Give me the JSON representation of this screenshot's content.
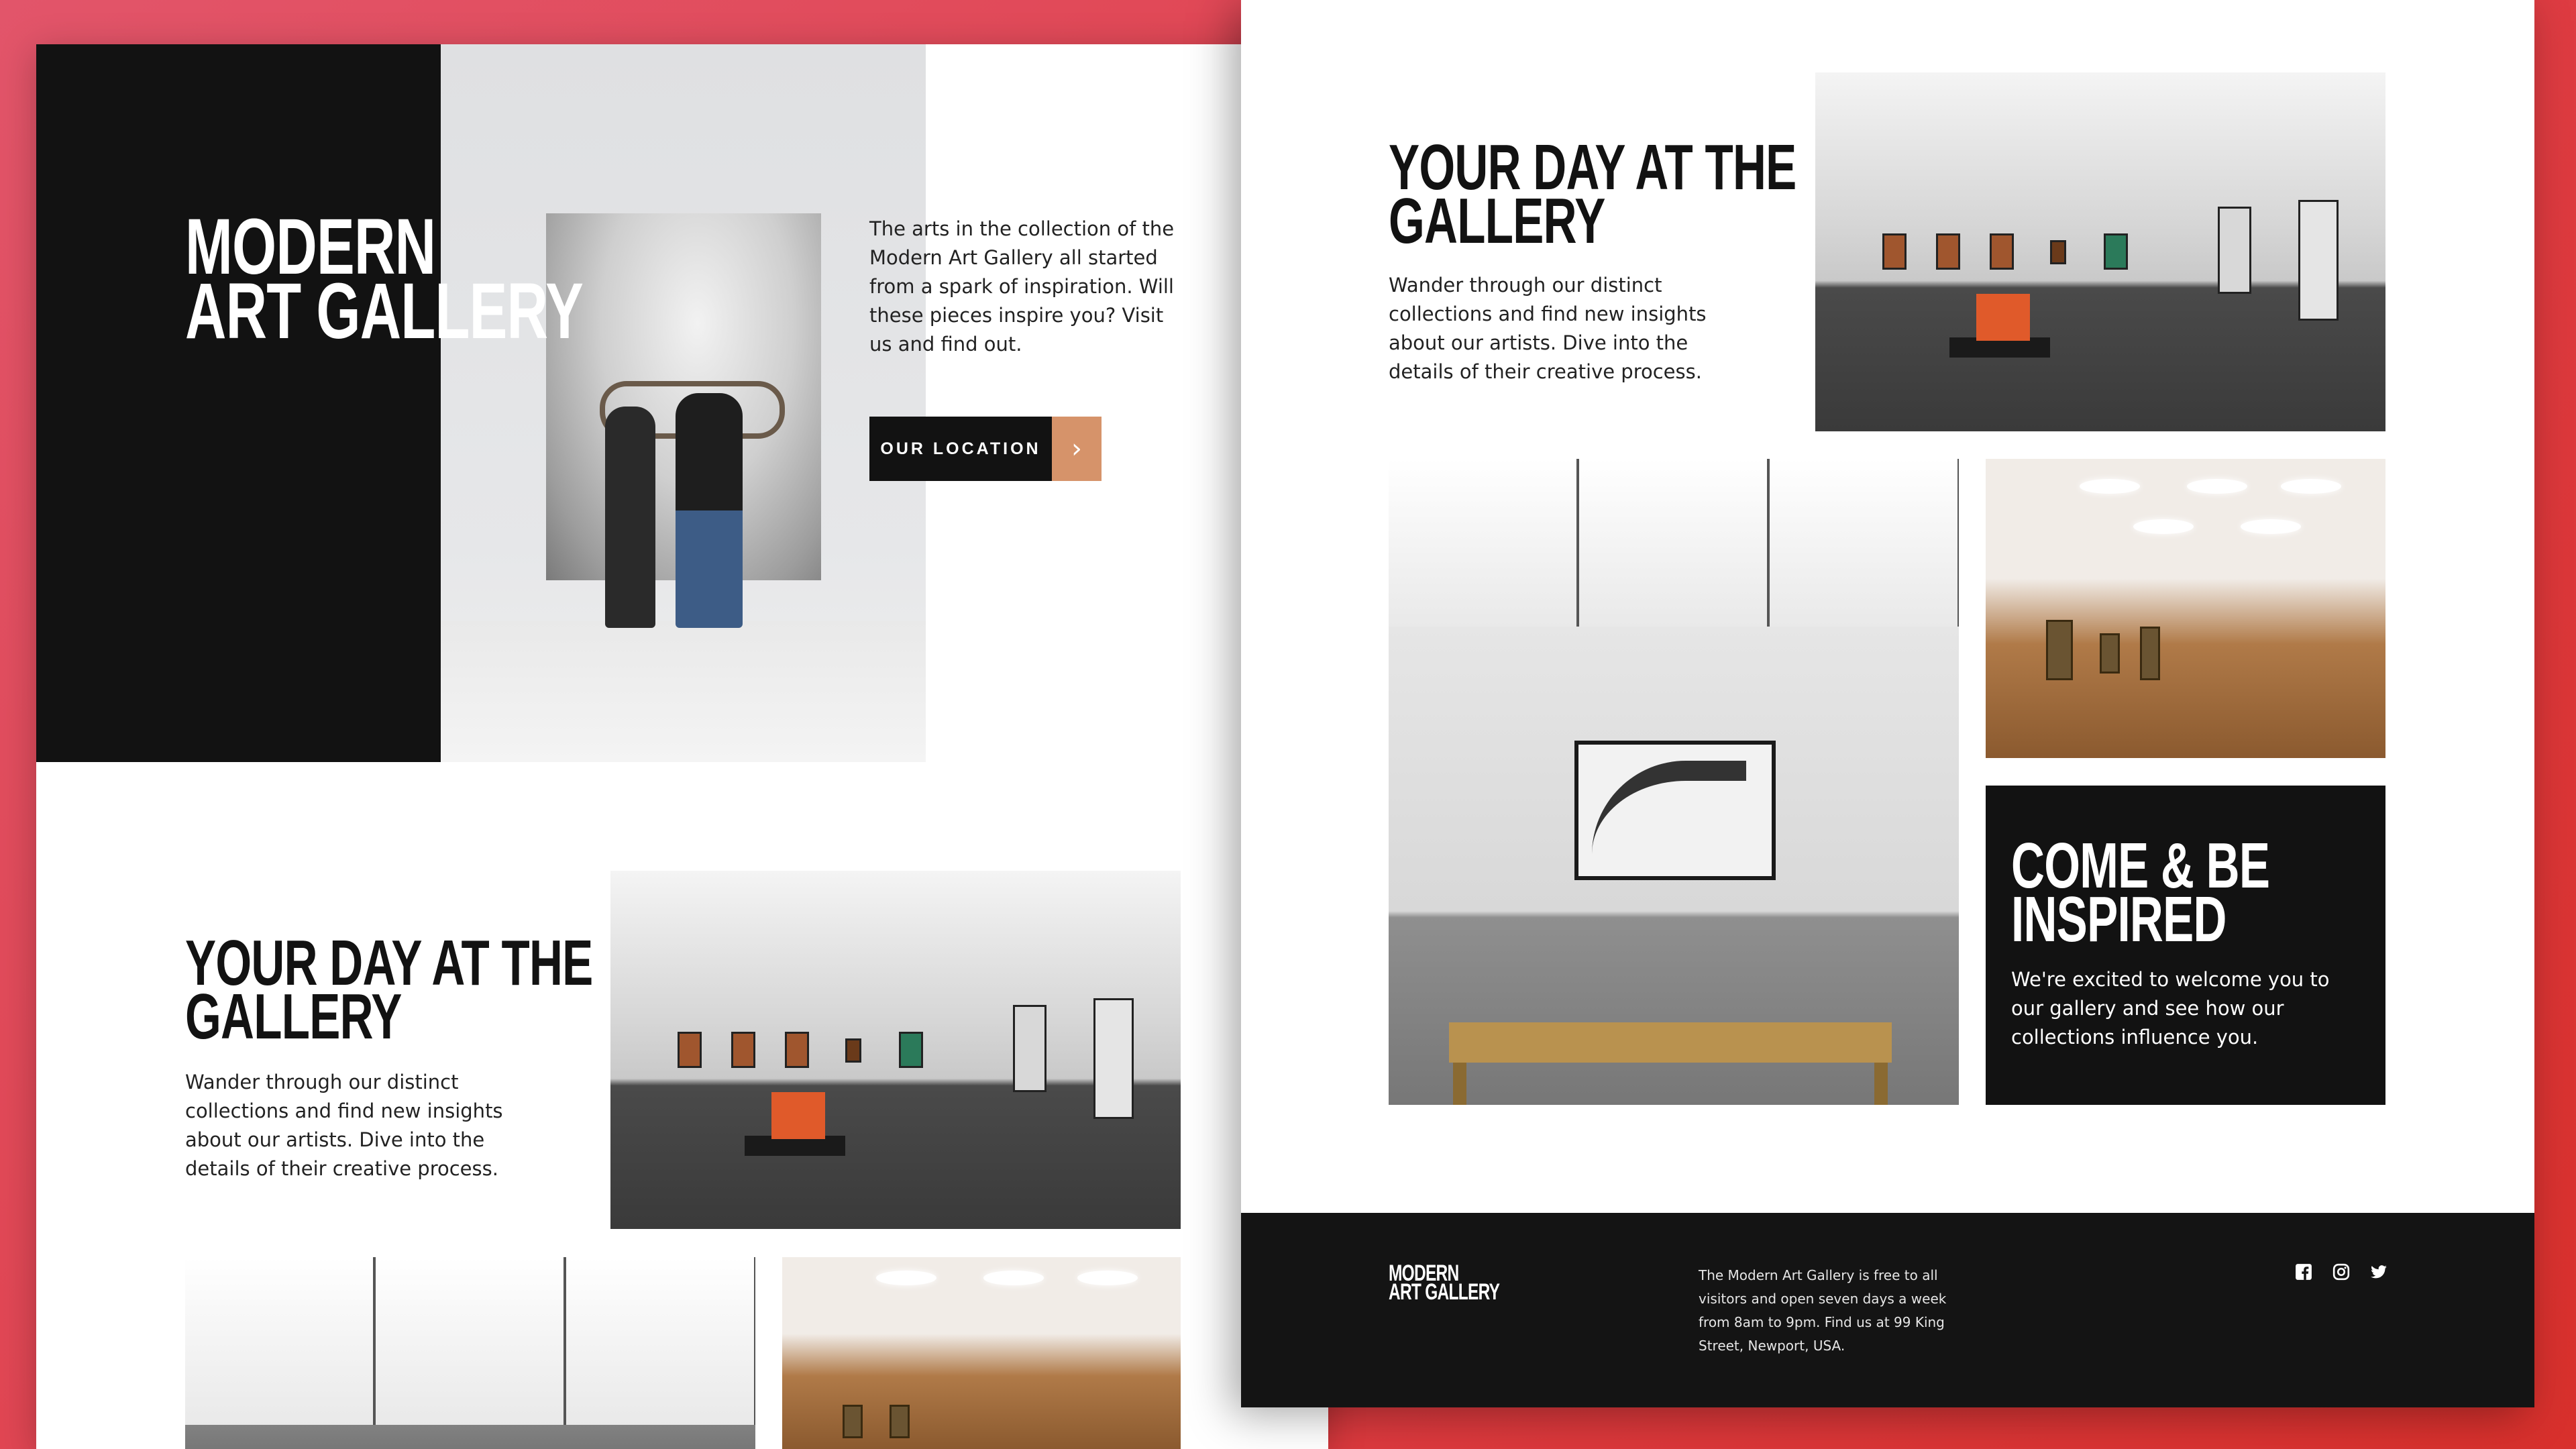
{
  "hero": {
    "title_line1": "Modern",
    "title_line2": "Art Gallery",
    "intro": "The arts in the collection of the Modern Art Gallery all started from a spark of inspiration. Will these pieces inspire you? Visit us and find out.",
    "cta_label": "Our Location",
    "cta_arrow": "›"
  },
  "day_section": {
    "title_line1": "Your day at the",
    "title_line2": "gallery",
    "text": "Wander through our distinct collections and find new insights about our artists. Dive into the details of their creative process."
  },
  "inspired": {
    "title_line1": "Come & be",
    "title_line2": "inspired",
    "text": "We're excited to welcome you to our gallery and see how our collections influence you."
  },
  "footer": {
    "logo_line1": "Modern",
    "logo_line2": "Art Gallery",
    "info": "The Modern Art Gallery is free to all visitors and open seven days a week from 8am to 9pm. Find us at 99 King Street, Newport, USA.",
    "social_icons": [
      "facebook-icon",
      "instagram-icon",
      "twitter-icon"
    ]
  },
  "colors": {
    "background_red": "#e0404a",
    "dark": "#121212",
    "accent": "#d6936a",
    "white": "#ffffff"
  }
}
